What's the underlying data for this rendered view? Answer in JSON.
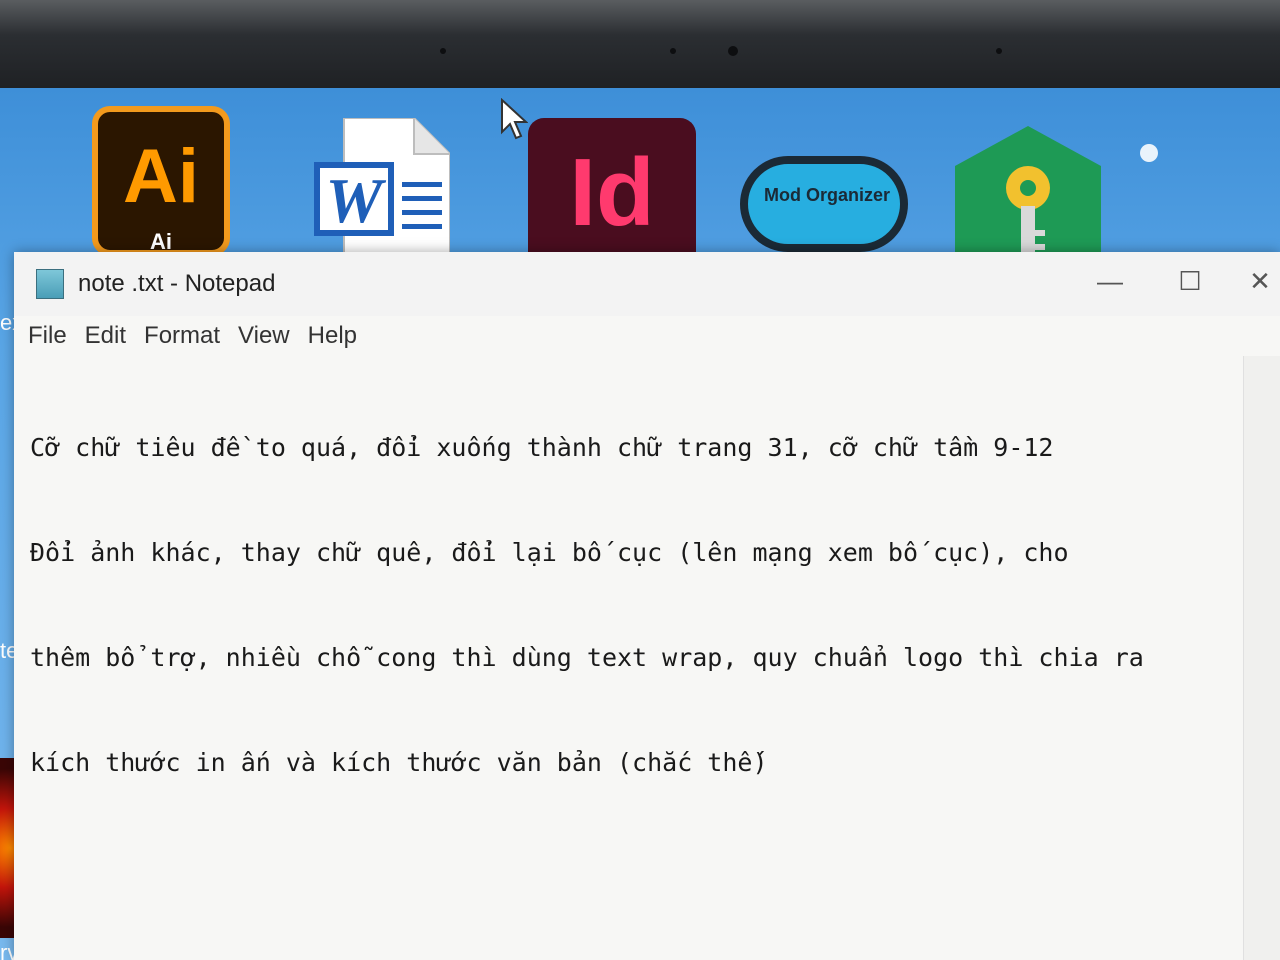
{
  "desktop": {
    "icons": [
      {
        "name": "illustrator",
        "label": "Ai",
        "sublabel": "Ai"
      },
      {
        "name": "word-document",
        "label": "W"
      },
      {
        "name": "indesign",
        "label": "Id"
      },
      {
        "name": "mod-organizer",
        "label": "Mod Organizer"
      },
      {
        "name": "key-manager"
      }
    ],
    "left_fragments": [
      "ex",
      "ter.e",
      "rvivor"
    ]
  },
  "window": {
    "title": "note .txt - Notepad",
    "controls": {
      "minimize": "—",
      "maximize": "☐",
      "close": "✕"
    },
    "menu": [
      "File",
      "Edit",
      "Format",
      "View",
      "Help"
    ],
    "content": {
      "lines": [
        "Cỡ chữ tiêu đề to quá, đổi xuống thành chữ trang 31, cỡ chữ tầm 9-12",
        "Đổi ảnh khác, thay chữ quê, đổi lại bố cục (lên mạng xem bố cục), cho",
        "thêm bổ trợ, nhiều chỗ cong thì dùng text wrap, quy chuẩn logo thì chia ra",
        "kích thước in ấn và kích thước văn bản (chắc thế)"
      ]
    }
  },
  "colors": {
    "desktop_top": "#3e8fd8",
    "illustrator_orange": "#ff9a00",
    "indesign_pink": "#ff3a6e",
    "mod_organizer_blue": "#27aee0",
    "key_green": "#1e9a55"
  }
}
